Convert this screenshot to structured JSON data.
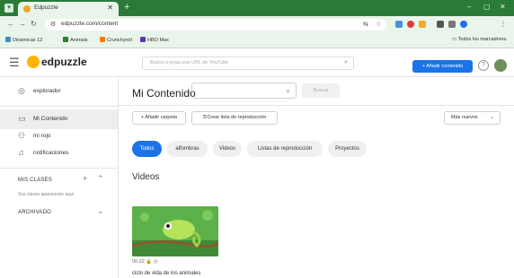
{
  "browser": {
    "tab_title": "Edpuzzle",
    "new_tab": "+",
    "url": "edpuzzle.com/content",
    "window_controls": [
      "–",
      "▢",
      "✕"
    ],
    "bookmarks": [
      {
        "label": "Dinámicas 12",
        "color": "#3c8dbc"
      },
      {
        "label": "Animals",
        "color": "#2e7d32"
      },
      {
        "label": "Crunchyroll",
        "color": "#f57c00"
      },
      {
        "label": "HBO Max",
        "color": "#5e35b1"
      }
    ],
    "bookmarks_right": "Todos los marcadores"
  },
  "header": {
    "logo": "edpuzzle",
    "search_placeholder": "Busca o pega una URL de YouTube",
    "add_content": "+ Añadir contenido",
    "help": "?"
  },
  "sidebar": {
    "items": [
      {
        "label": "explorador",
        "icon": "compass-icon"
      },
      {
        "label": "Mi Contenido",
        "icon": "folder-icon"
      },
      {
        "label": "mi rojo",
        "icon": "people-icon"
      },
      {
        "label": "notificaciones",
        "icon": "bell-icon"
      }
    ],
    "classes_title": "MIS CLASES",
    "classes_empty": "Sus clases aparecerán aquí",
    "archived_title": "ARCHIVADO"
  },
  "main": {
    "title": "Mi Contenido",
    "search_button": "Buscar",
    "add_folder": "+ Añadir carpeta",
    "create_playlist": "Crear lista de reproducción",
    "sort_label": "Más nuevos",
    "filters": [
      "Todos",
      "alfombras",
      "Videos",
      "Listas de reproducción",
      "Proyectos"
    ],
    "section_title": "Videos",
    "video": {
      "duration": "00:22",
      "title": "ciclo de vida de los animales"
    }
  },
  "colors": {
    "chrome": "#2f7d3c",
    "accent": "#1a73e8",
    "logo": "#ffb400"
  }
}
